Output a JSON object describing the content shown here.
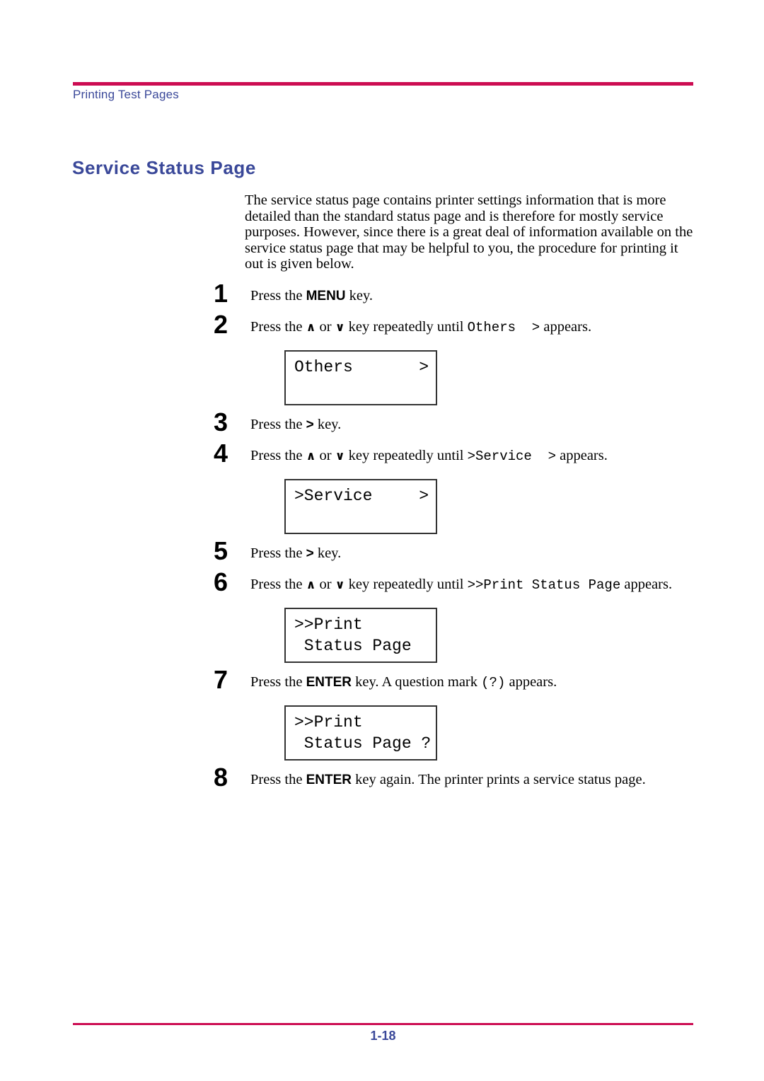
{
  "header": {
    "running_head": "Printing Test Pages",
    "rule_color": "#cc0c52",
    "text_color": "#3a4899"
  },
  "section": {
    "heading": "Service Status Page",
    "heading_color": "#3a4899"
  },
  "intro": {
    "paragraph": "The service status page contains printer settings information that is more detailed than the standard status page and is therefore for mostly service purposes. However, since there is a great deal of information available on the service status page that may be helpful to you, the procedure for printing it out is given below."
  },
  "steps": {
    "s1": {
      "number": "1",
      "pre": "Press the ",
      "key": "MENU",
      "post": " key."
    },
    "s2": {
      "number": "2",
      "pre": "Press the ",
      "up": "∧",
      "mid": " or ",
      "down": "∨",
      "post": " key repeatedly until ",
      "mono": "Others  >",
      "tail": " appears."
    },
    "s3": {
      "number": "3",
      "pre": "Press the ",
      "key": ">",
      "post": " key."
    },
    "s4": {
      "number": "4",
      "pre": "Press the ",
      "up": "∧",
      "mid": " or ",
      "down": "∨",
      "post": " key repeatedly until ",
      "mono": ">Service  >",
      "tail": " appears."
    },
    "s5": {
      "number": "5",
      "pre": "Press the ",
      "key": ">",
      "post": " key."
    },
    "s6": {
      "number": "6",
      "pre": "Press the ",
      "up": "∧",
      "mid": " or ",
      "down": "∨",
      "post": " key repeatedly until ",
      "mono": ">>Print Status Page",
      "tail": " appears."
    },
    "s7": {
      "number": "7",
      "pre": "Press the ",
      "key": "ENTER",
      "post": " key. A question mark ",
      "mono": "(?)",
      "tail": " appears."
    },
    "s8": {
      "number": "8",
      "pre": "Press the ",
      "key": "ENTER",
      "post": " key again. The printer prints a service status page."
    }
  },
  "lcd_panels": {
    "others": {
      "left": "Others",
      "right": ">"
    },
    "service": {
      "left": ">Service",
      "right": ">"
    },
    "print_status": {
      "line1": ">>Print",
      "line2": " Status Page"
    },
    "print_status_query": {
      "line1": ">>Print",
      "line2": " Status Page ?"
    }
  },
  "footer": {
    "page_number": "1-18",
    "rule_color": "#cc0c52",
    "text_color": "#3a4899"
  }
}
